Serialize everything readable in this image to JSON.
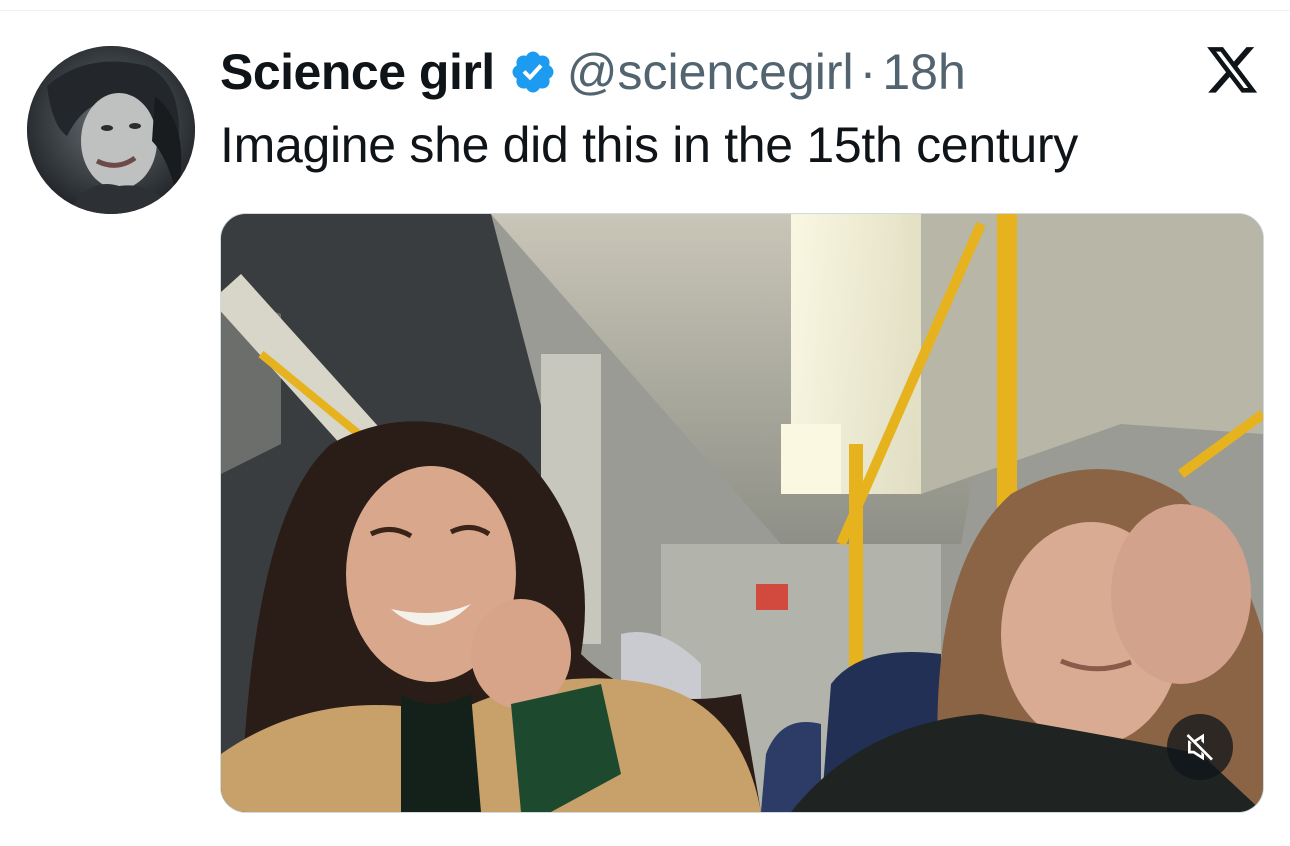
{
  "tweet": {
    "display_name": "Science girl",
    "verified": true,
    "handle": "@sciencegirl",
    "separator": "·",
    "time": "18h",
    "text": "Imagine she did this in the 15th century"
  },
  "media": {
    "type": "video",
    "muted": true
  },
  "icons": {
    "verified": "verified-badge-icon",
    "brand": "x-logo-icon",
    "mute": "speaker-muted-icon"
  },
  "colors": {
    "verified_blue": "#1d9bf0",
    "text_primary": "#0f1419",
    "text_secondary": "#536471",
    "pole_yellow": "#e6b21e"
  }
}
